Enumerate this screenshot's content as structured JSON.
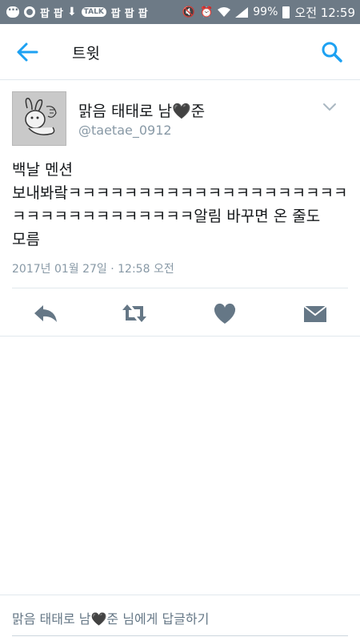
{
  "status_bar": {
    "left_chips": [
      "팝",
      "팝",
      "팝",
      "팝",
      "팝"
    ],
    "battery": "99%",
    "time": "오전 12:59"
  },
  "app_bar": {
    "title": "트윗",
    "back_icon": "arrow-left-icon",
    "search_icon": "search-icon"
  },
  "tweet": {
    "display_name": "맑음 태태로 남🖤준",
    "username": "@taetae_0912",
    "text_lines": [
      "백날 멘션",
      "보내봐랔ㅋㅋㅋㅋㅋㅋㅋㅋㅋㅋㅋㅋㅋㅋㅋㅋㅋㅋㅋㅋ",
      "ㅋㅋㅋㅋㅋㅋㅋㅋㅋㅋㅋㅋㅋ알림 바꾸면 온 줄도",
      "모름"
    ],
    "timestamp": "2017년 01월 27일 · 12:58 오전"
  },
  "actions": {
    "reply_icon": "reply-icon",
    "retweet_icon": "retweet-icon",
    "like_icon": "heart-icon",
    "dm_icon": "envelope-icon"
  },
  "reply_bar": {
    "placeholder": "맑음 태태로 남🖤준 님에게 답글하기"
  },
  "colors": {
    "accent": "#1da1f2",
    "status_bar": "#6d7a86",
    "action_icons": "#657786",
    "secondary_text": "#8899a6"
  }
}
